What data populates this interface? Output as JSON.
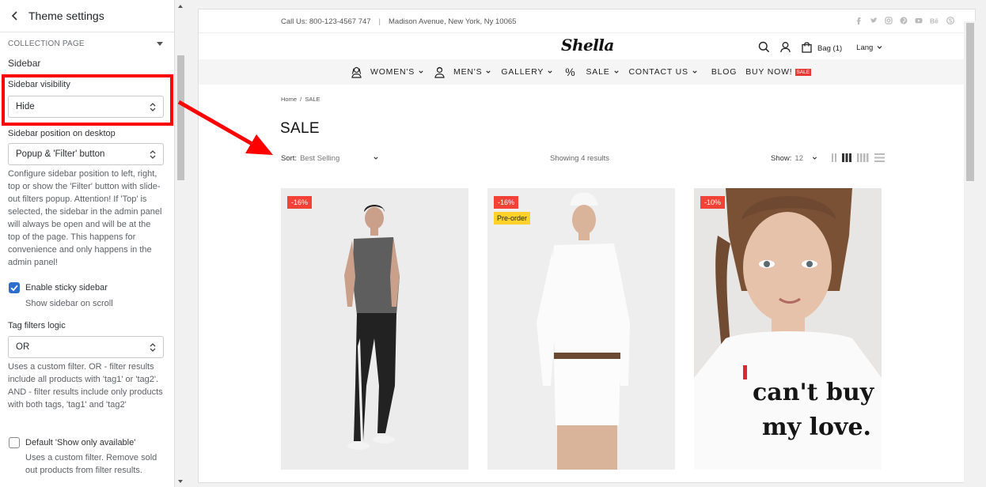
{
  "panel": {
    "title": "Theme settings",
    "section": "COLLECTION PAGE",
    "group_heading": "Sidebar",
    "visibility": {
      "label": "Sidebar visibility",
      "value": "Hide"
    },
    "position": {
      "label": "Sidebar position on desktop",
      "value": "Popup & 'Filter' button",
      "help": "Configure sidebar position to left, right, top or show the 'Filter' button with slide-out filters popup. Attention! If 'Top' is selected, the sidebar in the admin panel will always be open and will be at the top of the page. This happens for convenience and only happens in the admin panel!"
    },
    "sticky": {
      "label": "Enable sticky sidebar",
      "sub": "Show sidebar on scroll",
      "checked": true
    },
    "tag_logic": {
      "label": "Tag filters logic",
      "value": "OR",
      "help": "Uses a custom filter. OR - filter results include all products with 'tag1' or 'tag2'. AND - filter results include only products with both tags, 'tag1' and 'tag2'"
    },
    "only_available": {
      "label": "Default 'Show only available'",
      "sub": "Uses a custom filter. Remove sold out products from filter results.",
      "checked": false
    }
  },
  "store": {
    "phone": "Call Us: 800-123-4567 747",
    "divider": "|",
    "address": "Madison Avenue, New York, Ny 10065",
    "social_icons": [
      "facebook-icon",
      "twitter-icon",
      "instagram-icon",
      "pinterest-icon",
      "youtube-icon",
      "behance-icon",
      "skype-icon"
    ],
    "logo": "Shella",
    "bag": "Bag (1)",
    "lang": "Lang",
    "nav": {
      "womens": "WOMEN'S",
      "mens": "MEN'S",
      "gallery": "GALLERY",
      "percent": "%",
      "sale": "SALE",
      "contact": "CONTACT US",
      "blog": "BLOG",
      "buy": "BUY NOW!",
      "buy_badge": "SALE"
    },
    "breadcrumb": "Home  /  SALE",
    "heading": "SALE",
    "sort_label": "Sort:",
    "sort_value": "Best Selling",
    "showing": "Showing 4 results",
    "show_label": "Show:",
    "show_value": "12",
    "products": [
      {
        "discount": "-16%",
        "preorder": ""
      },
      {
        "discount": "-16%",
        "preorder": "Pre-order"
      },
      {
        "discount": "-10%",
        "preorder": ""
      }
    ]
  },
  "colors": {
    "highlight": "#ff0000",
    "accent": "#2c6ecb",
    "sale": "#f44336",
    "preorder": "#ffd22b"
  }
}
